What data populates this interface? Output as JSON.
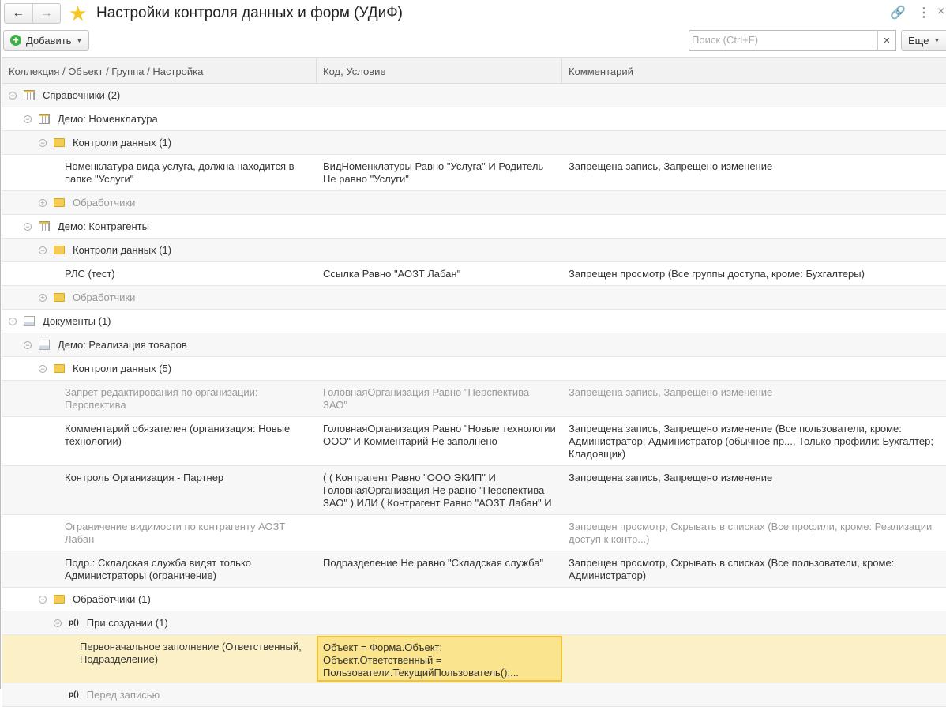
{
  "window": {
    "title": "Настройки контроля данных и форм (УДиФ)",
    "back_icon": "arrow-left",
    "forward_icon": "arrow-right",
    "favorite_icon": "star",
    "link_icon": "link",
    "menu_icon": "more-vertical",
    "close_icon": "close"
  },
  "toolbar": {
    "add_label": "Добавить",
    "search_placeholder": "Поиск (Ctrl+F)",
    "more_label": "Еще"
  },
  "columns": [
    "Коллекция / Объект / Группа / Настройка",
    "Код, Условие",
    "Комментарий"
  ],
  "colors": {
    "selected_row": "#fcf1c6",
    "selected_cell": "#fbe48e",
    "accent": "#f2c230"
  },
  "rows": [
    {
      "level": 0,
      "toggle": "minus",
      "icon": "table",
      "name": "Справочники (2)",
      "code": "",
      "comment": ""
    },
    {
      "level": 1,
      "toggle": "minus",
      "icon": "table",
      "name": "Демо: Номенклатура",
      "code": "",
      "comment": ""
    },
    {
      "level": 2,
      "toggle": "minus",
      "icon": "folder",
      "name": "Контроли данных (1)",
      "code": "",
      "comment": ""
    },
    {
      "level": 3,
      "name": "Номенклатура вида услуга, должна находится в папке \"Услуги\"",
      "code": "ВидНоменклатуры Равно \"Услуга\" И Родитель Не равно \"Услуги\"",
      "comment": "Запрещена запись, Запрещено изменение"
    },
    {
      "level": 2,
      "toggle": "plus",
      "icon": "folder",
      "name": "Обработчики",
      "code": "",
      "comment": "",
      "disabled": true
    },
    {
      "level": 1,
      "toggle": "minus",
      "icon": "table",
      "name": "Демо: Контрагенты",
      "code": "",
      "comment": ""
    },
    {
      "level": 2,
      "toggle": "minus",
      "icon": "folder",
      "name": "Контроли данных (1)",
      "code": "",
      "comment": ""
    },
    {
      "level": 3,
      "name": "РЛС (тест)",
      "code": "Ссылка Равно \"АОЗТ Лабан\"",
      "comment": "Запрещен просмотр (Все группы доступа, кроме: Бухгалтеры)"
    },
    {
      "level": 2,
      "toggle": "plus",
      "icon": "folder",
      "name": "Обработчики",
      "code": "",
      "comment": "",
      "disabled": true
    },
    {
      "level": 0,
      "toggle": "minus",
      "icon": "doc",
      "name": "Документы (1)",
      "code": "",
      "comment": ""
    },
    {
      "level": 1,
      "toggle": "minus",
      "icon": "doc",
      "name": "Демо: Реализация товаров",
      "code": "",
      "comment": ""
    },
    {
      "level": 2,
      "toggle": "minus",
      "icon": "folder",
      "name": "Контроли данных (5)",
      "code": "",
      "comment": ""
    },
    {
      "level": 3,
      "name": "Запрет редактирования по организации: Перспектива",
      "code": "ГоловнаяОрганизация Равно \"Перспектива ЗАО\"",
      "comment": "Запрещена запись, Запрещено изменение",
      "disabled": true
    },
    {
      "level": 3,
      "name": "Комментарий обязателен (организация: Новые технологии)",
      "code": "ГоловнаяОрганизация Равно \"Новые технологии ООО\" И Комментарий Не заполнено",
      "comment": "Запрещена запись, Запрещено изменение (Все пользователи, кроме: Администратор; Администратор (обычное пр..., Только профили: Бухгалтер; Кладовщик)"
    },
    {
      "level": 3,
      "name": "Контроль Организация - Партнер",
      "code": "( ( Контрагент Равно \"ООО ЭКИП\" И ГоловнаяОрганизация Не равно \"Перспектива ЗАО\" ) ИЛИ ( Контрагент Равно \"АОЗТ Лабан\" И",
      "comment": "Запрещена запись, Запрещено изменение"
    },
    {
      "level": 3,
      "name": "Ограничение видимости по контрагенту АОЗТ Лабан",
      "code": "",
      "comment": "Запрещен просмотр, Скрывать в списках (Все профили, кроме: Реализации доступ к контр...)",
      "disabled": true
    },
    {
      "level": 3,
      "name": "Подр.: Складская служба видят только Администраторы (ограничение)",
      "code": "Подразделение Не равно \"Складская служба\"",
      "comment": "Запрещен просмотр, Скрывать в списках (Все пользователи, кроме: Администратор)"
    },
    {
      "level": 2,
      "toggle": "minus",
      "icon": "folder",
      "name": "Обработчики (1)",
      "code": "",
      "comment": ""
    },
    {
      "level": 3,
      "toggle": "minus",
      "icon": "proc",
      "icon_text": "р()",
      "name": "При создании (1)",
      "code": "",
      "comment": ""
    },
    {
      "level": 4,
      "name": "Первоначальное заполнение (Ответственный, Подразделение)",
      "code": "Объект = Форма.Объект;\nОбъект.Ответственный = Пользователи.ТекущийПользователь();...",
      "comment": "",
      "selected": true
    },
    {
      "level": 3,
      "toggle": "none",
      "icon": "proc",
      "icon_text": "р()",
      "name": "Перед записью",
      "code": "",
      "comment": "",
      "disabled": true
    }
  ]
}
